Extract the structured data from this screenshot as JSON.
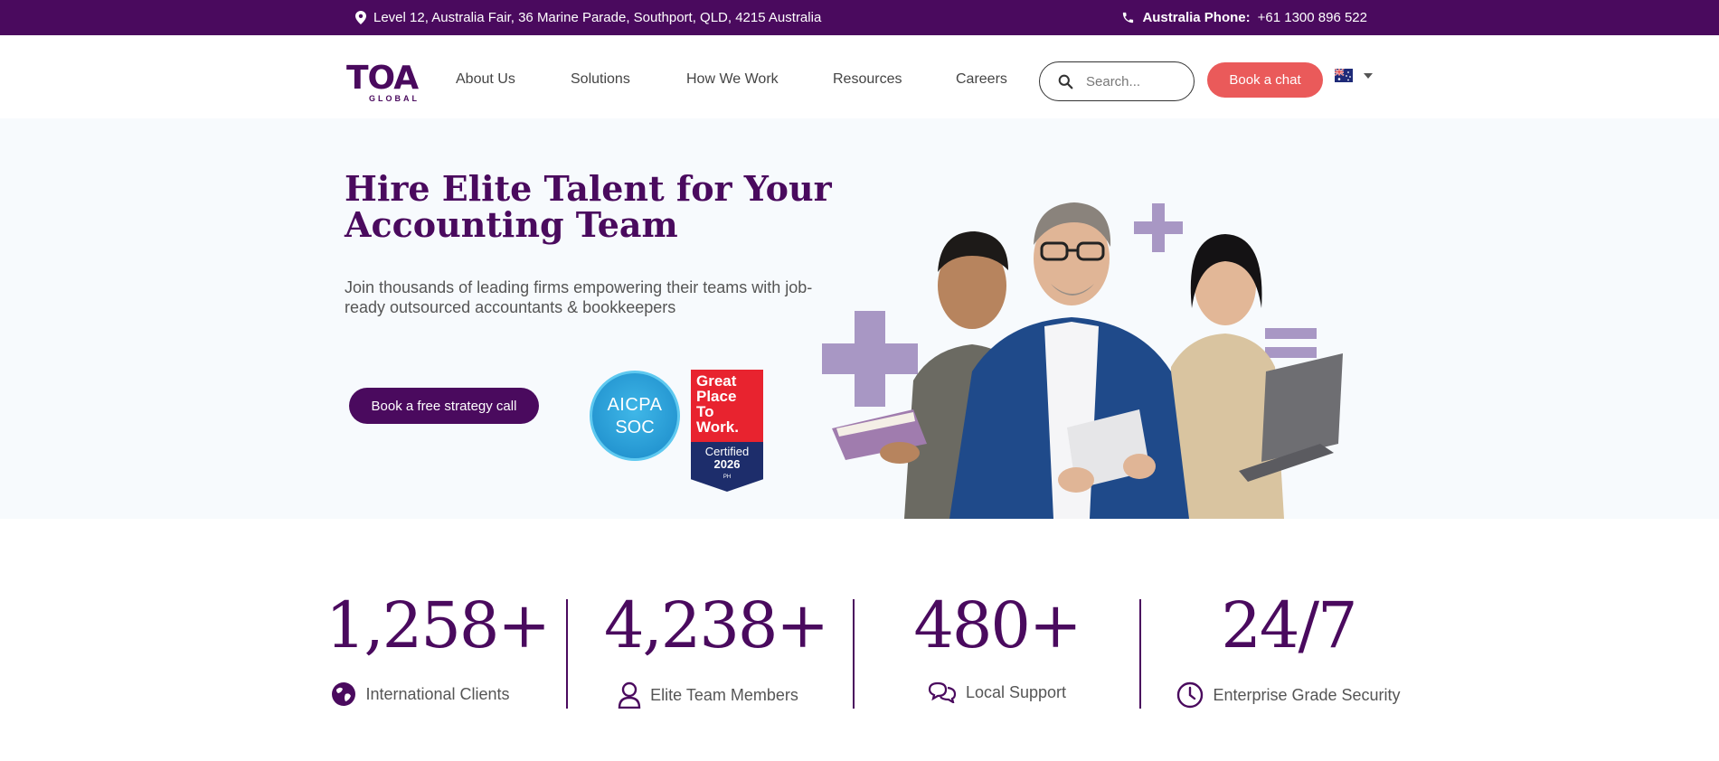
{
  "topbar": {
    "address": "Level 12, Australia Fair, 36 Marine Parade, Southport, QLD, 4215 Australia",
    "phone_label": "Australia Phone:",
    "phone_number": "+61 1300 896 522",
    "icons": [
      "map-pin-icon",
      "phone-icon"
    ]
  },
  "header": {
    "logo_main": "TOA",
    "logo_sub": "GLOBAL",
    "nav": [
      "About Us",
      "Solutions",
      "How We Work",
      "Resources",
      "Careers"
    ],
    "search_placeholder": "Search...",
    "chat_button": "Book a chat"
  },
  "hero": {
    "title": "Hire Elite Talent for Your Accounting Team",
    "subtitle": "Join thousands of leading firms empowering their teams with job-ready outsourced accountants & bookkeepers",
    "cta": "Book a free strategy call",
    "aicpa": {
      "line1": "AICPA",
      "line2": "SOC"
    },
    "gptw": {
      "line1": "Great",
      "line2": "Place",
      "line3": "To",
      "line4": "Work.",
      "certified": "Certified",
      "year": "2026",
      "country": "PH"
    }
  },
  "stats": [
    {
      "value": "1,258+",
      "label": "International Clients",
      "icon": "globe-icon"
    },
    {
      "value": "4,238+",
      "label": "Elite Team Members",
      "icon": "user-icon"
    },
    {
      "value": "480+",
      "label": "Local Support",
      "icon": "chat-icon"
    },
    {
      "value": "24/7",
      "label": "Enterprise Grade Security",
      "icon": "clock-icon"
    }
  ],
  "colors": {
    "brand": "#4a0a5e",
    "accent": "#ea5a5a",
    "hero_bg": "#f7fafd",
    "plus": "#a897c4"
  }
}
